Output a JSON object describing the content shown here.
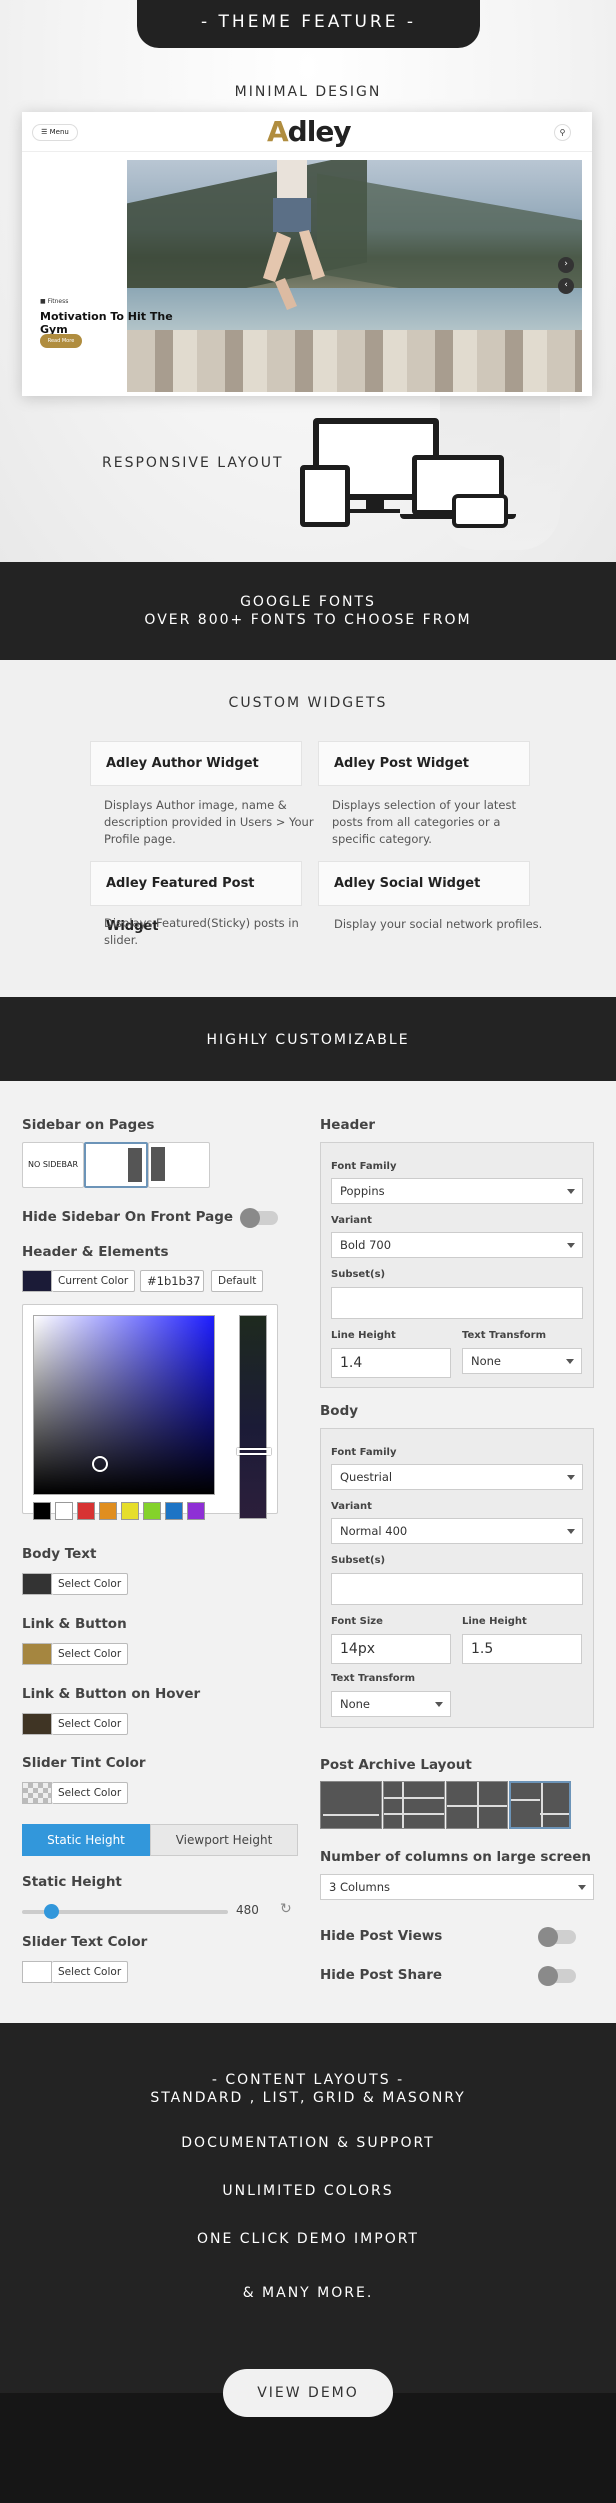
{
  "top_banner": "- THEME FEATURE -",
  "minimal_design": "MINIMAL DESIGN",
  "mockup": {
    "menu_label": "☰ Menu",
    "logo_a": "A",
    "logo_rest": "dley",
    "post_category": "Fitness",
    "post_title": "Motivation To Hit The Gym",
    "read_more": "Read More"
  },
  "responsive_layout": "RESPONSIVE LAYOUT",
  "google_fonts": {
    "line1": "GOOGLE FONTS",
    "line2": "OVER 800+ FONTS TO CHOOSE FROM"
  },
  "custom_widgets": {
    "heading": "CUSTOM WIDGETS",
    "widgets": [
      {
        "title": "Adley Author Widget",
        "desc": "Displays Author image, name & description provided in Users > Your Profile page."
      },
      {
        "title": "Adley Post Widget",
        "desc": "Displays selection of your latest posts from all categories or a specific category."
      },
      {
        "title": "Adley Featured Post Widget",
        "desc": "Displays Featured(Sticky) posts in slider."
      },
      {
        "title": "Adley Social Widget",
        "desc": "Display your social network profiles."
      }
    ]
  },
  "highly_customizable": "HIGHLY CUSTOMIZABLE",
  "customizer": {
    "left": {
      "sidebar_on_pages": "Sidebar on Pages",
      "no_sidebar": "NO SIDEBAR",
      "hide_sidebar_front": "Hide Sidebar On Front Page",
      "header_elements": "Header & Elements",
      "current_color": "Current Color",
      "color_value": "#1b1b37",
      "default_btn": "Default",
      "body_text": "Body Text",
      "link_button": "Link & Button",
      "link_button_hover": "Link & Button on Hover",
      "slider_tint": "Slider Tint Color",
      "select_color": "Select Color",
      "static_height_btn": "Static Height",
      "viewport_height_btn": "Viewport Height",
      "static_height_label": "Static Height",
      "static_height_value": "480",
      "static_height_fraction": 0.14,
      "slider_text_color": "Slider Text Color"
    },
    "right": {
      "header": "Header",
      "font_family_label": "Font Family",
      "header_font": "Poppins",
      "variant_label": "Variant",
      "header_variant": "Bold 700",
      "subsets_label": "Subset(s)",
      "line_height_label": "Line Height",
      "text_transform_label": "Text Transform",
      "header_line_height": "1.4",
      "header_transform": "None",
      "body": "Body",
      "body_font": "Questrial",
      "body_variant": "Normal 400",
      "font_size_label": "Font Size",
      "body_font_size": "14px",
      "body_line_height": "1.5",
      "body_transform": "None",
      "post_archive_layout": "Post Archive Layout",
      "columns_label": "Number of columns on large screen",
      "columns_value": "3 Columns",
      "hide_post_views": "Hide Post Views",
      "hide_post_share": "Hide Post Share"
    },
    "colors": {
      "header_swatch": "#1b1b37",
      "body_text_swatch": "#333333",
      "link_swatch": "#a58640",
      "link_hover_swatch": "#3f3424",
      "accent_blue": "#3297db"
    }
  },
  "content_layouts": {
    "line1": "- CONTENT LAYOUTS -",
    "line2": "STANDARD , LIST, GRID & MASONRY",
    "items": [
      "DOCUMENTATION & SUPPORT",
      "UNLIMITED COLORS",
      "ONE CLICK DEMO IMPORT",
      "& MANY MORE."
    ]
  },
  "view_demo": "VIEW DEMO"
}
